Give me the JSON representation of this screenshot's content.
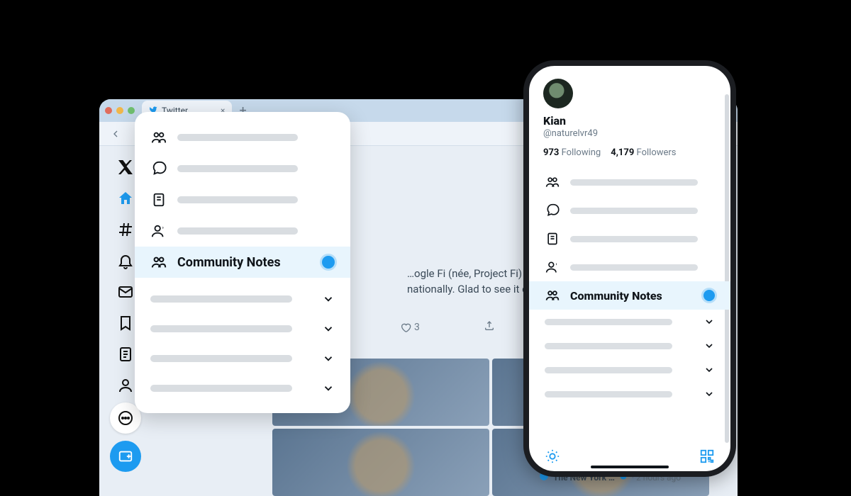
{
  "browser": {
    "tab_title": "Twitter",
    "tab_close": "×",
    "tab_add": "+"
  },
  "feed": {
    "snippet": "…ogle Fi (née, Project Fi) for several …nationally. Glad to see it coming to …ts…",
    "like_count": "3",
    "bottom_source": "The New York …",
    "bottom_time": "2 hours ago"
  },
  "popover": {
    "community_notes": "Community Notes"
  },
  "phone": {
    "name": "Kian",
    "handle": "@naturelvr49",
    "following_count": "973",
    "following_label": "Following",
    "followers_count": "4,179",
    "followers_label": "Followers",
    "community_notes": "Community Notes"
  }
}
